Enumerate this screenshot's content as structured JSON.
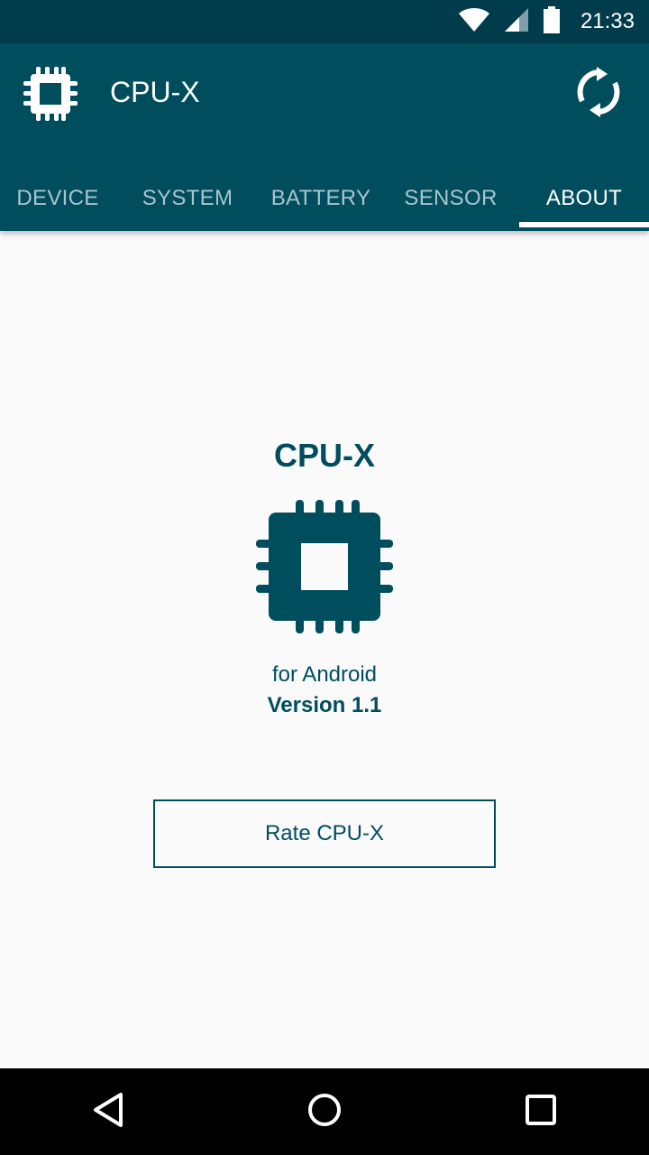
{
  "status_bar": {
    "time": "21:33",
    "icons": [
      "wifi-icon",
      "cell-signal-icon",
      "battery-icon"
    ]
  },
  "toolbar": {
    "title": "CPU-X",
    "logo_icon": "chip-icon",
    "refresh_icon": "refresh-icon"
  },
  "tabs": [
    {
      "label": "DEVICE",
      "active": false
    },
    {
      "label": "SYSTEM",
      "active": false
    },
    {
      "label": "BATTERY",
      "active": false
    },
    {
      "label": "SENSOR",
      "active": false
    },
    {
      "label": "ABOUT",
      "active": true
    }
  ],
  "about": {
    "title": "CPU-X",
    "logo_icon": "chip-icon",
    "subtitle": "for Android",
    "version": "Version 1.1",
    "rate_button": "Rate CPU-X"
  },
  "nav_bar": {
    "icons": [
      "back-icon",
      "home-icon",
      "recents-icon"
    ]
  },
  "colors": {
    "primary": "#004d5e",
    "primary_dark": "#003c4c",
    "background": "#fafafa",
    "tab_inactive": "#a9c5cc"
  }
}
